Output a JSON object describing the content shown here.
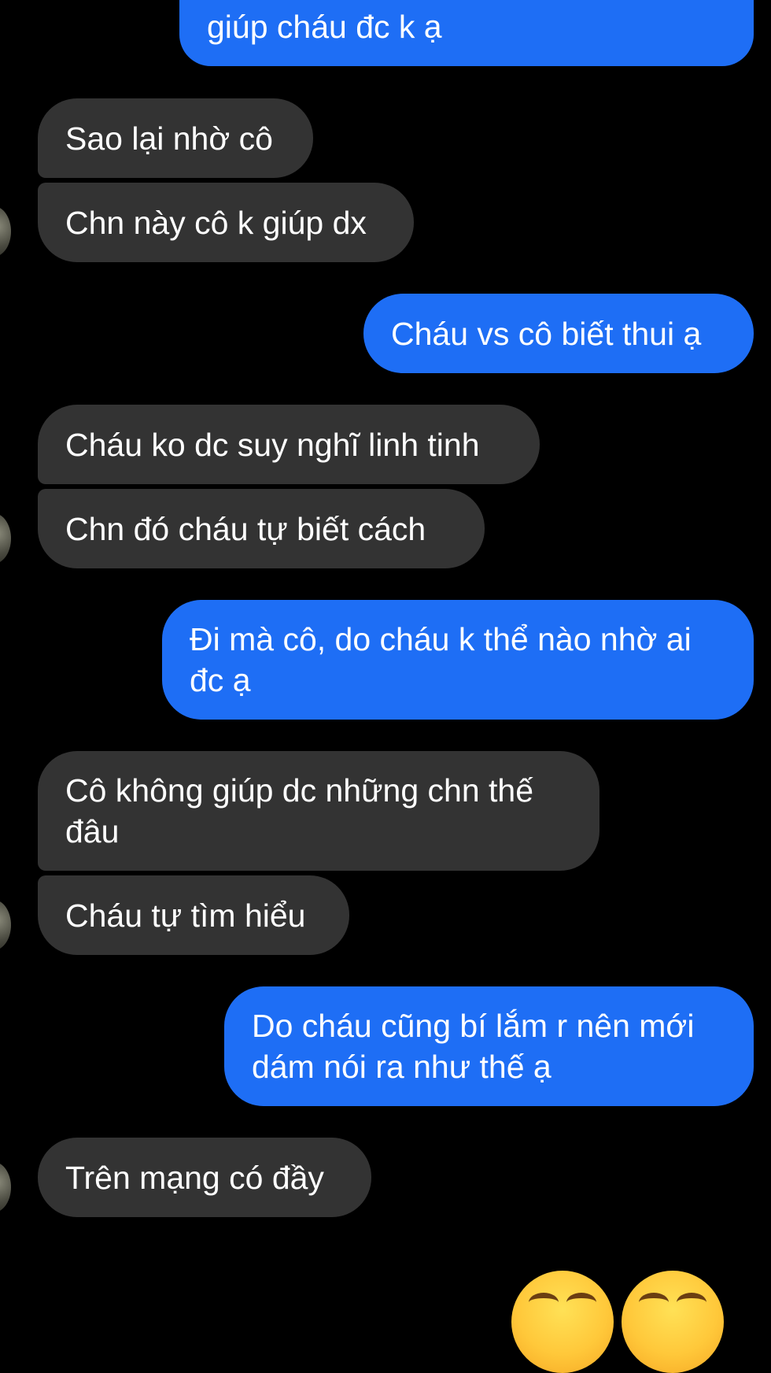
{
  "conversation": {
    "messages": [
      {
        "id": "m1",
        "direction": "outgoing",
        "text": "giúp cháu đc k ạ"
      },
      {
        "id": "m2",
        "direction": "incoming",
        "text": "Sao lại nhờ cô"
      },
      {
        "id": "m3",
        "direction": "incoming",
        "text": "Chn này cô k giúp dx"
      },
      {
        "id": "m4",
        "direction": "outgoing",
        "text": "Cháu vs cô biết thui ạ"
      },
      {
        "id": "m5",
        "direction": "incoming",
        "text": "Cháu ko dc suy nghĩ linh tinh"
      },
      {
        "id": "m6",
        "direction": "incoming",
        "text": "Chn đó cháu tự biết cách"
      },
      {
        "id": "m7",
        "direction": "outgoing",
        "text": "Đi mà cô, do cháu k thể nào nhờ ai đc ạ"
      },
      {
        "id": "m8",
        "direction": "incoming",
        "text": "Cô không giúp dc những chn thế đâu"
      },
      {
        "id": "m9",
        "direction": "incoming",
        "text": "Cháu tự tìm hiểu"
      },
      {
        "id": "m10",
        "direction": "outgoing",
        "text": "Do cháu cũng bí lắm r nên mới dám nói ra như thế ạ"
      },
      {
        "id": "m11",
        "direction": "incoming",
        "text": "Trên mạng có đầy"
      }
    ],
    "reactions": [
      "smiling-emoji-icon",
      "smiling-emoji-icon"
    ]
  },
  "colors": {
    "background": "#000000",
    "incoming_bubble": "#333333",
    "outgoing_bubble": "#1e6ef5",
    "text": "#ffffff"
  }
}
